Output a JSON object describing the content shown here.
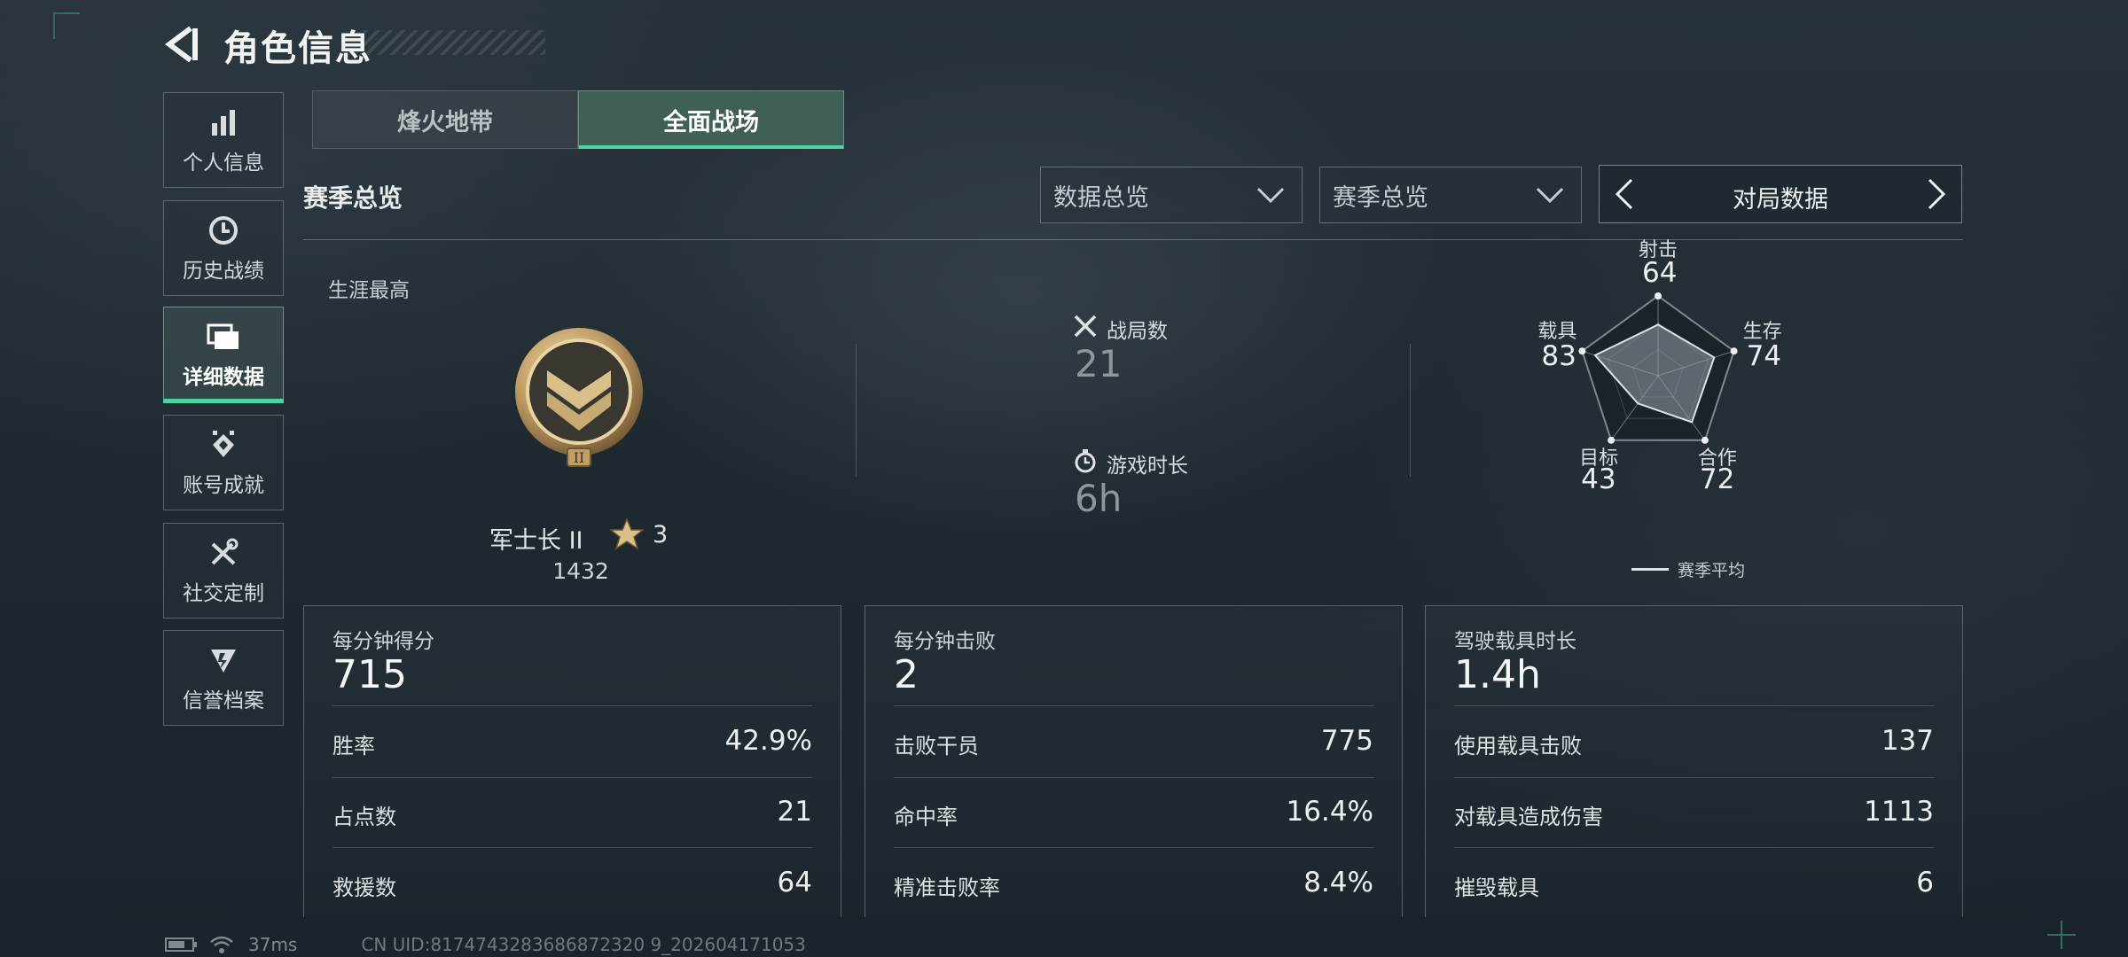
{
  "header": {
    "title": "角色信息"
  },
  "sidebar": {
    "items": [
      {
        "label": "个人信息",
        "icon": "bar-chart-icon"
      },
      {
        "label": "历史战绩",
        "icon": "clock-icon"
      },
      {
        "label": "详细数据",
        "icon": "folder-icon",
        "active": true
      },
      {
        "label": "账号成就",
        "icon": "achievement-icon"
      },
      {
        "label": "社交定制",
        "icon": "tools-icon"
      },
      {
        "label": "信誉档案",
        "icon": "shield-icon"
      }
    ]
  },
  "mode_tabs": [
    {
      "label": "烽火地带",
      "active": false
    },
    {
      "label": "全面战场",
      "active": true
    }
  ],
  "section_title": "赛季总览",
  "filters": {
    "data_dropdown": "数据总览",
    "season_dropdown": "赛季总览",
    "pager_label": "对局数据"
  },
  "overview": {
    "career_label": "生涯最高",
    "rank_name": "军士长 II",
    "rank_stars": "3",
    "rank_score": "1432",
    "matches_label": "战局数",
    "matches_value": "21",
    "playtime_label": "游戏时长",
    "playtime_value": "6h"
  },
  "radar": {
    "axes": [
      {
        "label": "射击",
        "value": 64
      },
      {
        "label": "生存",
        "value": 74
      },
      {
        "label": "合作",
        "value": 72
      },
      {
        "label": "目标",
        "value": 43
      },
      {
        "label": "载具",
        "value": 83
      }
    ],
    "legend": "赛季平均"
  },
  "cards": {
    "score": {
      "title": "每分钟得分",
      "big": "715",
      "rows": [
        {
          "label": "胜率",
          "value": "42.9%"
        },
        {
          "label": "占点数",
          "value": "21"
        },
        {
          "label": "救援数",
          "value": "64"
        }
      ]
    },
    "kills": {
      "title": "每分钟击败",
      "big": "2",
      "rows": [
        {
          "label": "击败干员",
          "value": "775"
        },
        {
          "label": "命中率",
          "value": "16.4%"
        },
        {
          "label": "精准击败率",
          "value": "8.4%"
        }
      ]
    },
    "vehicle": {
      "title": "驾驶载具时长",
      "big": "1.4h",
      "rows": [
        {
          "label": "使用载具击败",
          "value": "137"
        },
        {
          "label": "对载具造成伤害",
          "value": "1113"
        },
        {
          "label": "摧毁载具",
          "value": "6"
        }
      ]
    }
  },
  "status": {
    "ping": "37ms",
    "uid": "CN UID:8174743283686872320 9_202604171053"
  },
  "colors": {
    "accent": "#4fd3a3",
    "tab_active": "#3f5f58",
    "background": "#1f2930"
  }
}
